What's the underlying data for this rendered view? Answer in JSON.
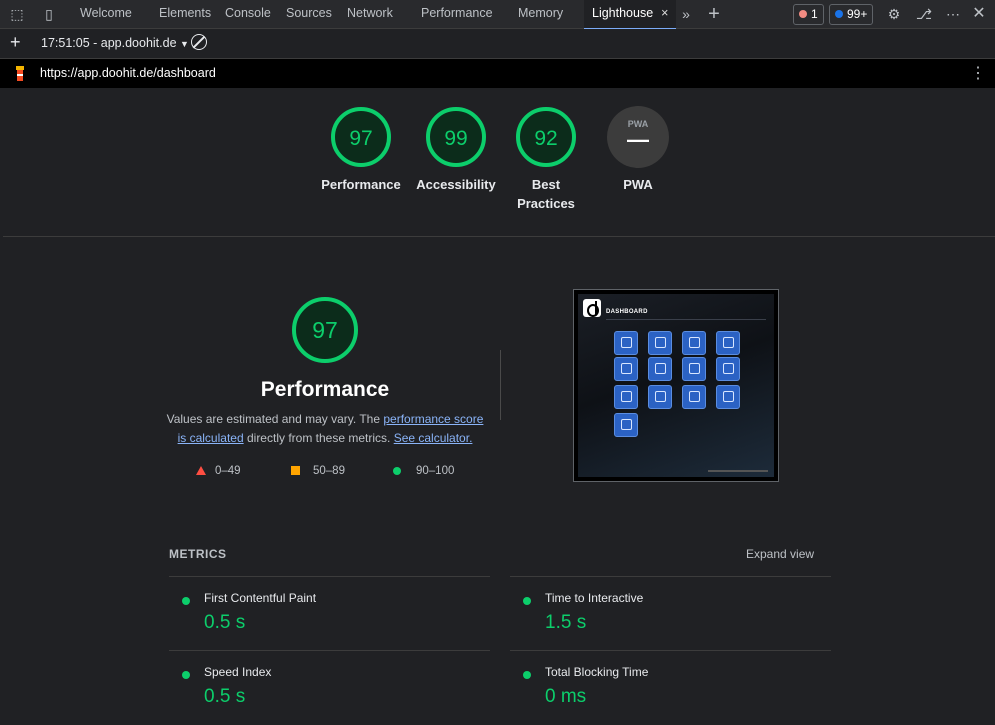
{
  "devtools": {
    "tabs": [
      "Welcome",
      "Elements",
      "Console",
      "Sources",
      "Network",
      "Performance",
      "Memory"
    ],
    "active_tab": "Lighthouse",
    "errors_count": "1",
    "issues_count": "99+"
  },
  "toolbar": {
    "report": "17:51:05 - app.doohit.de"
  },
  "url": "https://app.doohit.de/dashboard",
  "gauges": [
    {
      "score": "97",
      "label": "Performance",
      "label2": ""
    },
    {
      "score": "99",
      "label": "Accessibility",
      "label2": ""
    },
    {
      "score": "92",
      "label": "Best",
      "label2": "Practices"
    },
    {
      "score": "—",
      "label": "PWA",
      "label2": "",
      "badge": "PWA"
    }
  ],
  "performance": {
    "score": "97",
    "title": "Performance",
    "desc_pre": "Values are estimated and may vary. The ",
    "link1": "performance score is calculated",
    "desc_mid": " directly from these metrics. ",
    "link2": "See calculator."
  },
  "legend": [
    {
      "range": "0–49",
      "color": "#ff4e42"
    },
    {
      "range": "50–89",
      "color": "#ffa400"
    },
    {
      "range": "90–100",
      "color": "#0cce6b"
    }
  ],
  "screenshot": {
    "title": "DASHBOARD"
  },
  "metrics": {
    "heading": "METRICS",
    "expand": "Expand view",
    "items": [
      {
        "label": "First Contentful Paint",
        "value": "0.5 s"
      },
      {
        "label": "Time to Interactive",
        "value": "1.5 s"
      },
      {
        "label": "Speed Index",
        "value": "0.5 s"
      },
      {
        "label": "Total Blocking Time",
        "value": "0 ms"
      }
    ]
  },
  "colors": {
    "good": "#0cce6b",
    "accent": "#7cacf8",
    "link": "#8ab4f8"
  }
}
